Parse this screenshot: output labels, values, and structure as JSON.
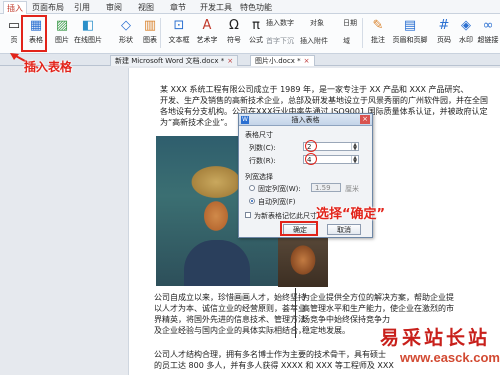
{
  "menu": {
    "tabs": [
      "插入",
      "页面布局",
      "引用",
      "审阅",
      "视图",
      "章节",
      "开发工具",
      "特色功能"
    ]
  },
  "ribbon": {
    "buttons": [
      "页",
      "表格",
      "图片",
      "在线图片",
      "形状",
      "图表",
      "文本框",
      "艺术字",
      "符号",
      "公式"
    ],
    "small": {
      "insert_number": "插入数字",
      "object": "对象",
      "date": "日期",
      "first_drop": "首字下沉",
      "attachment": "插入附件",
      "field": "域",
      "comment": "批注",
      "header_footer": "页眉和页脚",
      "page_number": "页码",
      "watermark": "水印",
      "hyperlink": "超链接"
    }
  },
  "doc_tabs": [
    "新建 Microsoft Word 文档.docx *",
    "图片小.docx *"
  ],
  "annotations": {
    "insert_table": "插入表格",
    "select_ok": "选择“确定”"
  },
  "document": {
    "p1": [
      "某 XXX 系统工程有限公司成立于 1989 年，是一家专注于 XX 产品和 XXX 产品研究、",
      "开发、生产及销售的高新技术企业，总部及研发基地设立于风景秀丽的广州软件园，并在全国",
      "各地设有分支机构。公司在XXX行业中率先通过 ISO9001 国际质量体系认证，并被政府认定",
      "为“高新技术企业”。"
    ],
    "p2_left": [
      "公司自成立以来，珍惜画画人才，始终坚持",
      "以人才为本、诚信立业的经营原则，荟萃业",
      "界精英，将国外先进的信息技术、管理方法",
      "及企业经验与国内企业的具体实际相结合，"
    ],
    "p2_right": [
      "为企业提供全方位的解决方案，帮助企业提",
      "高管理水平和生产能力，使企业在激烈的市",
      "场竞争中始终保持竞争力",
      "稳定地发展。"
    ],
    "p3": [
      "公司人才结构合理，拥有多名博士作为主要的技术骨干，具有硕士",
      "的员工达 800 多人，并有多人获得 XXXX 和 XXX 等工程师及 XXX"
    ]
  },
  "dialog": {
    "title": "插入表格",
    "table_size": "表格尺寸",
    "cols_label": "列数(C):",
    "cols_value": "2",
    "rows_label": "行数(R):",
    "rows_value": "4",
    "col_width": "列宽选择",
    "fixed": "固定列宽(W):",
    "fixed_value": "1.59",
    "unit": "厘米",
    "auto": "自动列宽(F)",
    "remember": "为新表格记忆此尺寸",
    "ok": "确定",
    "cancel": "取消"
  },
  "watermark": {
    "cn": "易采站长站",
    "url": "www.easck.com"
  }
}
